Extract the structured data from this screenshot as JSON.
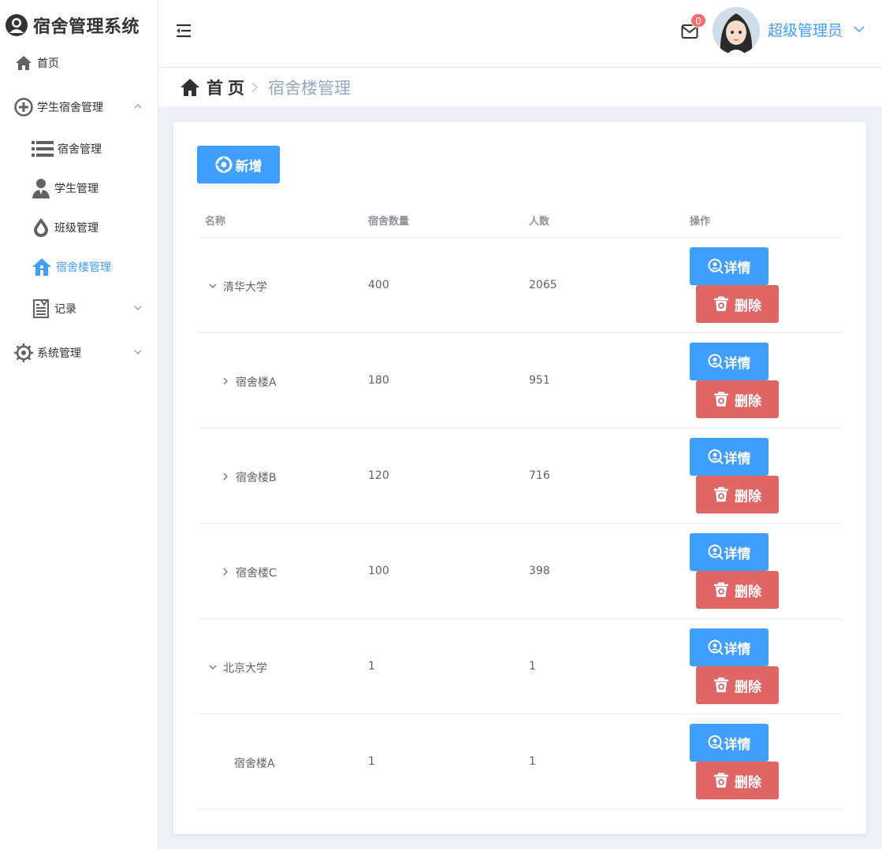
{
  "app": {
    "title": "宿舍管理系统"
  },
  "sidebar": {
    "items": [
      {
        "label": "首页"
      },
      {
        "label": "学生宿舍管理"
      },
      {
        "label": "宿舍管理"
      },
      {
        "label": "学生管理"
      },
      {
        "label": "班级管理"
      },
      {
        "label": "宿舍楼管理"
      },
      {
        "label": "记录"
      },
      {
        "label": "系统管理"
      }
    ]
  },
  "header": {
    "mail_count": "0",
    "user_name": "超级管理员"
  },
  "breadcrumb": {
    "home": "首页",
    "current": "宿舍楼管理"
  },
  "toolbar": {
    "add_label": "新增"
  },
  "table": {
    "columns": [
      "名称",
      "宿舍数量",
      "人数",
      "操作"
    ],
    "rows": [
      {
        "name": "清华大学",
        "dorms": "400",
        "people": "2065"
      },
      {
        "name": "宿舍楼A",
        "dorms": "180",
        "people": "951"
      },
      {
        "name": "宿舍楼B",
        "dorms": "120",
        "people": "716"
      },
      {
        "name": "宿舍楼C",
        "dorms": "100",
        "people": "398"
      },
      {
        "name": "北京大学",
        "dorms": "1",
        "people": "1"
      },
      {
        "name": "宿舍楼A",
        "dorms": "1",
        "people": "1"
      }
    ],
    "detail_label": "详情",
    "delete_label": "删除"
  }
}
